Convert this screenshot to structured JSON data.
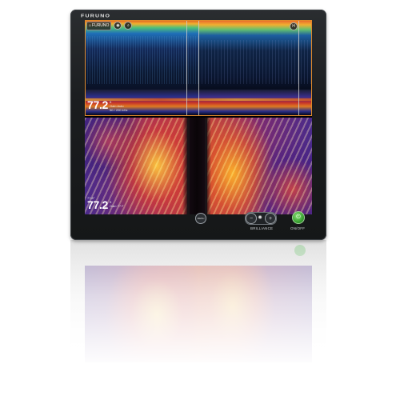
{
  "device": {
    "brand": "FURUNO",
    "accent_color": "#e08a2a",
    "power_color": "#3ea836"
  },
  "toolbar": {
    "home_label": "FURUNO",
    "home_icon": "home-icon",
    "waypoint_icon": "map-pin-icon",
    "search_icon": "search-icon",
    "echo_mode_label": "H"
  },
  "readouts": {
    "echo": {
      "depth": "77.2",
      "unit": "ft",
      "line1": "Gain Auto",
      "line2": "50 / 200 kHz"
    },
    "sonar": {
      "temp": "77.6°",
      "depth": "77.2",
      "unit": "ft",
      "line1": "Gain 77 F"
    }
  },
  "controls": {
    "menu_label": "MENU",
    "brilliance_minus": "−",
    "brilliance_icon": "sun-icon",
    "brilliance_plus": "+",
    "brilliance_label": "BRILLIANCE",
    "power_label": "ON/OFF",
    "power_icon": "power-icon"
  }
}
